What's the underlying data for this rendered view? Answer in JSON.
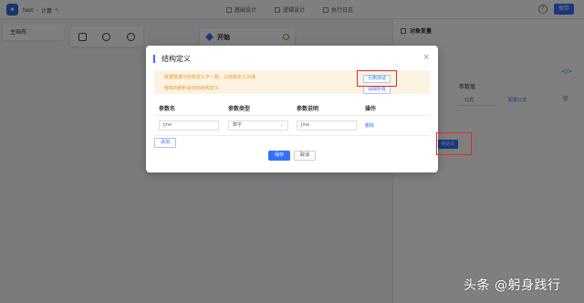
{
  "header": {
    "app_name": "test",
    "breadcrumb_sep": "›",
    "breadcrumb_current": "计算",
    "tabs": [
      {
        "label": "基础设计"
      },
      {
        "label": "逻辑设计"
      },
      {
        "label": "执行日志"
      }
    ],
    "help": "?",
    "save_label": "保存"
  },
  "canvas": {
    "main_tab": "主画布",
    "start_node_label": "开始"
  },
  "right_panel": {
    "title": "对象变量",
    "param_value_header": "参数值",
    "formula_option": "公式",
    "config_formula_link": "配置公式",
    "structure_def_button": "构定义"
  },
  "dialog": {
    "title": "结构定义",
    "warning_line1": "数据数据与结构定义不一致，以结构定义为准",
    "warning_line2": "整体的刷时会自动结构定义",
    "ref_test_button": "引用测试",
    "clear_all_button": "清除所有",
    "columns": [
      "参数名",
      "参数类型",
      "参数说明",
      "操作"
    ],
    "row": {
      "name": "jine",
      "type": "数字",
      "desc": "Jine",
      "action": "删除"
    },
    "add_button": "添加",
    "save_button": "保存",
    "cancel_button": "取消"
  },
  "watermark": "头条 @躬身践行",
  "colors": {
    "accent": "#3370ff",
    "warning_text": "#e59a2f",
    "warning_bg": "#fdf3e3",
    "highlight_box": "#e32b2b"
  }
}
